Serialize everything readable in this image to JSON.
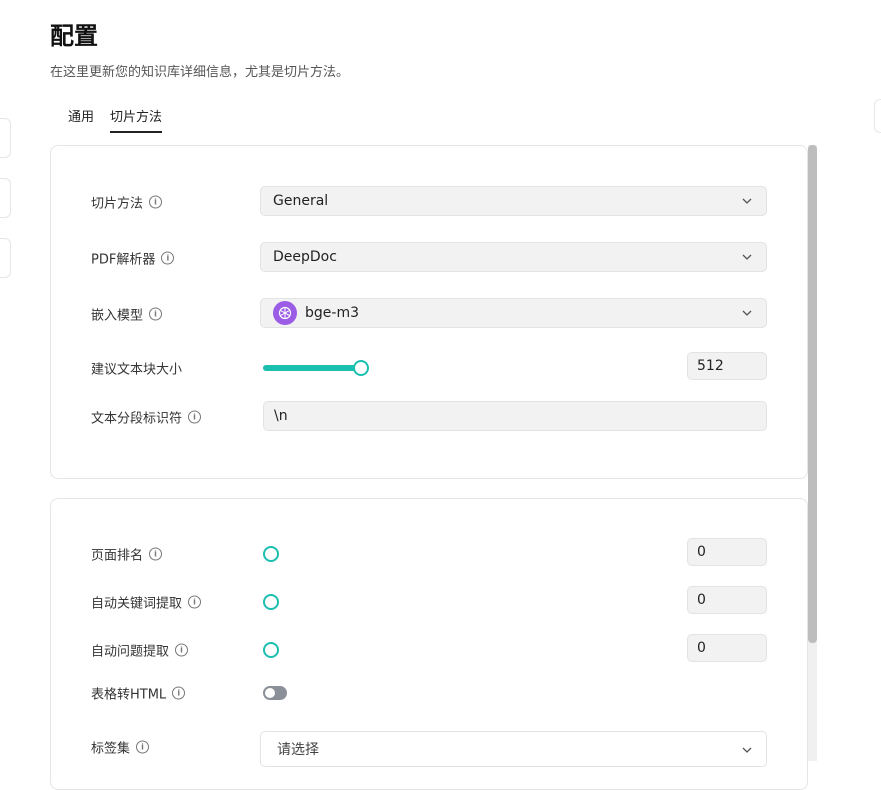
{
  "header": {
    "title": "配置",
    "description": "在这里更新您的知识库详细信息，尤其是切片方法。"
  },
  "tabs": [
    {
      "label": "通用",
      "active": false
    },
    {
      "label": "切片方法",
      "active": true
    }
  ],
  "general_card": {
    "chunk_method": {
      "label": "切片方法",
      "value": "General"
    },
    "pdf_parser": {
      "label": "PDF解析器",
      "value": "DeepDoc"
    },
    "embedding_model": {
      "label": "嵌入模型",
      "value": "bge-m3"
    },
    "chunk_token_size": {
      "label": "建议文本块大小",
      "value": "512"
    },
    "delimiter": {
      "label": "文本分段标识符",
      "value": "\\n"
    }
  },
  "advanced_card": {
    "page_rank": {
      "label": "页面排名",
      "value": "0"
    },
    "auto_keywords": {
      "label": "自动关键词提取",
      "value": "0"
    },
    "auto_questions": {
      "label": "自动问题提取",
      "value": "0"
    },
    "html4excel": {
      "label": "表格转HTML",
      "enabled": false
    },
    "tag_sets": {
      "label": "标签集",
      "placeholder": "请选择"
    }
  },
  "colors": {
    "accent": "#1bbfb0",
    "model_logo": "#9b5de5"
  }
}
